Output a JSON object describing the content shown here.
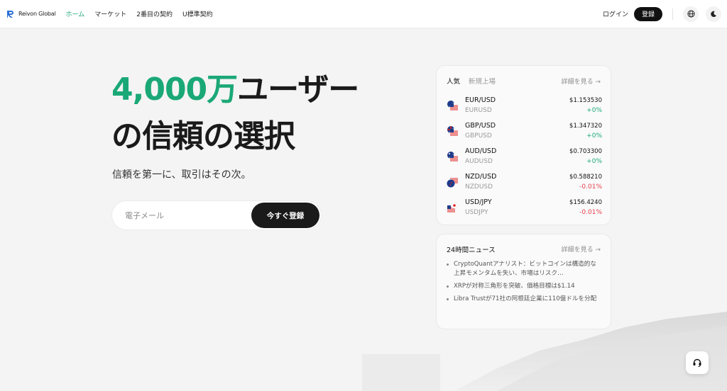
{
  "header": {
    "logo_text": "Reivon Global",
    "nav": [
      {
        "label": "ホーム",
        "active": true
      },
      {
        "label": "マーケット",
        "active": false
      },
      {
        "label": "2番目の契約",
        "active": false
      },
      {
        "label": "U標準契約",
        "active": false
      }
    ],
    "login_label": "ログイン",
    "signup_label": "登録",
    "icons": [
      "globe-icon",
      "moon-icon"
    ]
  },
  "hero": {
    "title_accent": "4,000万",
    "title_rest": "ユーザー",
    "title_line2": "の信頼の選択",
    "subtitle": "信頼を第一に、取引はその次。",
    "email_placeholder": "電子メール",
    "cta_label": "今すぐ登録"
  },
  "market": {
    "tabs": [
      {
        "label": "人気",
        "active": true
      },
      {
        "label": "新規上場",
        "active": false
      }
    ],
    "detail_link": "詳細を見る →",
    "rows": [
      {
        "pair": "EUR/USD",
        "symbol": "EURUSD",
        "price": "$1.153530",
        "change": "+0%",
        "direction": "up",
        "flag": "eu-us-flag-icon"
      },
      {
        "pair": "GBP/USD",
        "symbol": "GBPUSD",
        "price": "$1.347320",
        "change": "+0%",
        "direction": "up",
        "flag": "gb-us-flag-icon"
      },
      {
        "pair": "AUD/USD",
        "symbol": "AUDUSD",
        "price": "$0.703300",
        "change": "+0%",
        "direction": "up",
        "flag": "au-us-flag-icon"
      },
      {
        "pair": "NZD/USD",
        "symbol": "NZDUSD",
        "price": "$0.588210",
        "change": "-0.01%",
        "direction": "down",
        "flag": "nz-us-flag-icon"
      },
      {
        "pair": "USD/JPY",
        "symbol": "USDJPY",
        "price": "$156.4240",
        "change": "-0.01%",
        "direction": "down",
        "flag": "us-jp-flag-icon"
      }
    ]
  },
  "news": {
    "title": "24時間ニュース",
    "detail_link": "詳細を見る →",
    "items": [
      "CryptoQuantアナリスト：ビットコインは構造的な上昇モメンタムを失い、市場はリスク…",
      "XRPが対称三角形を突破、価格目標は$1.14",
      "Libra Trustが71社の阿根廷企業に110億ドルを分配"
    ]
  },
  "colors": {
    "accent": "#1aa877",
    "down": "#e5414a",
    "dark": "#111111"
  }
}
